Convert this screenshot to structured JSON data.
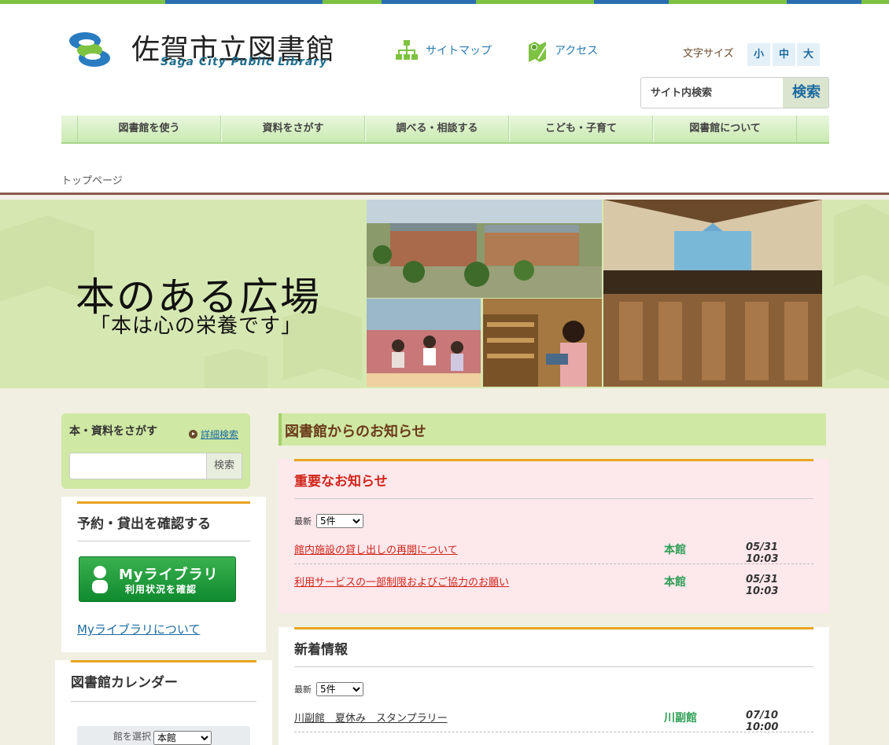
{
  "colors": {
    "accent_green": "#7dc241",
    "accent_blue": "#2a6db0",
    "nav_bg": "#c9eab1",
    "important_text": "#d0251b",
    "branch_text": "#2e9e55"
  },
  "header": {
    "title": "佐賀市立図書館",
    "title_en": "Saga City Public Library",
    "links": [
      {
        "label": "サイトマップ",
        "icon": "sitemap-icon"
      },
      {
        "label": "アクセス",
        "icon": "map-pin-icon"
      }
    ],
    "font_size": {
      "label": "文字サイズ",
      "small": "小",
      "medium": "中",
      "large": "大"
    },
    "search": {
      "placeholder": "サイト内検索",
      "button": "検索"
    }
  },
  "nav": {
    "items": [
      "図書館を使う",
      "資料をさがす",
      "調べる・相談する",
      "こども・子育て",
      "図書館について"
    ]
  },
  "breadcrumb": {
    "current": "トップページ"
  },
  "hero": {
    "title": "本のある広場",
    "subtitle": "「本は心の栄養です」"
  },
  "sidebar": {
    "search": {
      "title": "本・資料をさがす",
      "advanced": "詳細検索",
      "button": "検索"
    },
    "reservation": {
      "title": "予約・貸出を確認する",
      "my_library_title": "Myライブラリ",
      "my_library_sub": "利用状況を確認",
      "about_link": "Myライブラリについて"
    },
    "calendar": {
      "title": "図書館カレンダー",
      "select_label": "館を選択",
      "select_value": "本館"
    }
  },
  "main": {
    "news_heading": "図書館からのお知らせ",
    "important": {
      "title": "重要なお知らせ",
      "count_label": "最新",
      "count_value": "5件",
      "items": [
        {
          "title": "館内施設の貸し出しの再開について",
          "branch": "本館",
          "date": "05/31 10:03"
        },
        {
          "title": "利用サービスの一部制限およびご協力のお願い",
          "branch": "本館",
          "date": "05/31 10:03"
        }
      ]
    },
    "whats_new": {
      "title": "新着情報",
      "count_label": "最新",
      "count_value": "5件",
      "items": [
        {
          "title": "川副館　夏休み　スタンプラリー",
          "branch": "川副館",
          "date": "07/10 10:00"
        }
      ]
    }
  }
}
